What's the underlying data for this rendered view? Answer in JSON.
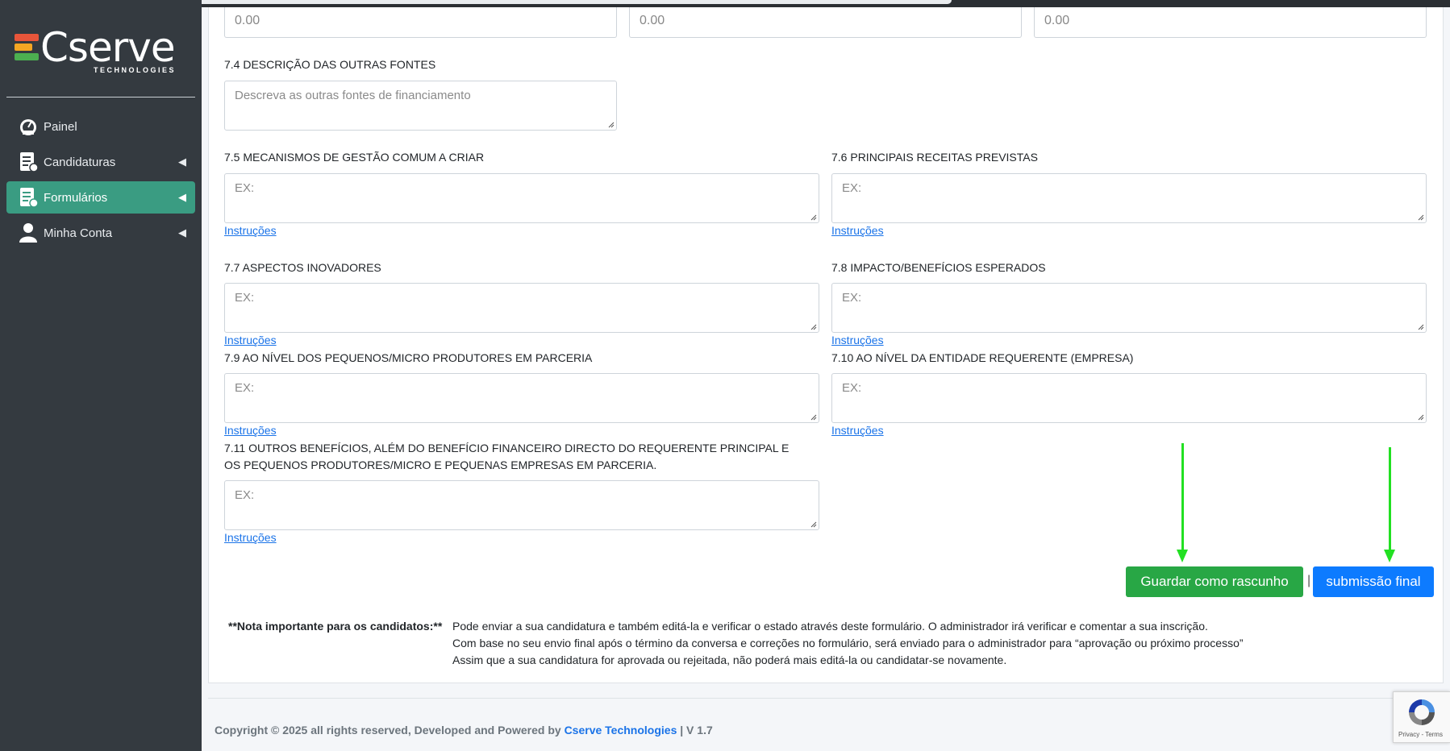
{
  "brand": {
    "name": "Cserve",
    "sub": "TECHNOLOGIES"
  },
  "sidebar": {
    "items": [
      {
        "label": "Painel",
        "icon": "dashboard-gauge-icon",
        "active": false,
        "chevron": false
      },
      {
        "label": "Candidaturas",
        "icon": "document-list-icon",
        "active": false,
        "chevron": true
      },
      {
        "label": "Formulários",
        "icon": "document-list-icon",
        "active": true,
        "chevron": true
      },
      {
        "label": "Minha Conta",
        "icon": "user-icon",
        "active": false,
        "chevron": true
      }
    ]
  },
  "form": {
    "top_inputs": [
      "0.00",
      "0.00",
      "0.00"
    ],
    "f74": {
      "label": "7.4 DESCRIÇÃO DAS OUTRAS FONTES",
      "placeholder": "Descreva as outras fontes de financiamento"
    },
    "f75": {
      "label": "7.5 MECANISMOS DE GESTÃO COMUM A CRIAR",
      "placeholder": "EX:",
      "link": "Instruções"
    },
    "f76": {
      "label": "7.6 PRINCIPAIS RECEITAS PREVISTAS",
      "placeholder": "EX:",
      "link": "Instruções"
    },
    "f77": {
      "label": "7.7 ASPECTOS INOVADORES",
      "placeholder": "EX:",
      "link": "Instruções"
    },
    "f78": {
      "label": "7.8 IMPACTO/BENEFÍCIOS ESPERADOS",
      "placeholder": "EX:",
      "link": "Instruções"
    },
    "f79": {
      "label": "7.9 AO NÍVEL DOS PEQUENOS/MICRO PRODUTORES EM PARCERIA",
      "placeholder": "EX:",
      "link": "Instruções"
    },
    "f710": {
      "label": "7.10 AO NÍVEL DA ENTIDADE REQUERENTE (EMPRESA)",
      "placeholder": "EX:",
      "link": "Instruções"
    },
    "f711": {
      "label_line1": "7.11 OUTROS BENEFÍCIOS, ALÉM DO BENEFÍCIO FINANCEIRO DIRECTO DO REQUERENTE PRINCIPAL E",
      "label_line2": "OS PEQUENOS PRODUTORES/MICRO E PEQUENAS EMPRESAS EM PARCERIA.",
      "placeholder": "EX:",
      "link": "Instruções"
    }
  },
  "actions": {
    "draft_label": "Guardar como rascunho",
    "separator": "|",
    "submit_label": "submissão final"
  },
  "note": {
    "title": "**Nota importante para os candidatos:**",
    "lines": [
      "Pode enviar a sua candidatura e também editá-la e verificar o estado através deste formulário. O administrador irá verificar e comentar a sua inscrição.",
      "Com base no seu envio final após o término da conversa e correções no formulário, será enviado para o administrador para “aprovação ou próximo processo”",
      "Assim que a sua candidatura for aprovada ou rejeitada, não poderá mais editá-la ou candidatar-se novamente."
    ]
  },
  "footer": {
    "prefix": "Copyright © 2025 all rights reserved, Developed and Powered by ",
    "link": "Cserve Technologies",
    "suffix": " | V 1.7"
  },
  "recaptcha": {
    "terms": "Privacy - Terms"
  },
  "colors": {
    "sidebar_bg": "#343a40",
    "active_bg": "#3a9c82",
    "draft_button": "#28a745",
    "submit_button": "#0d7bff",
    "arrow": "#22e022"
  }
}
